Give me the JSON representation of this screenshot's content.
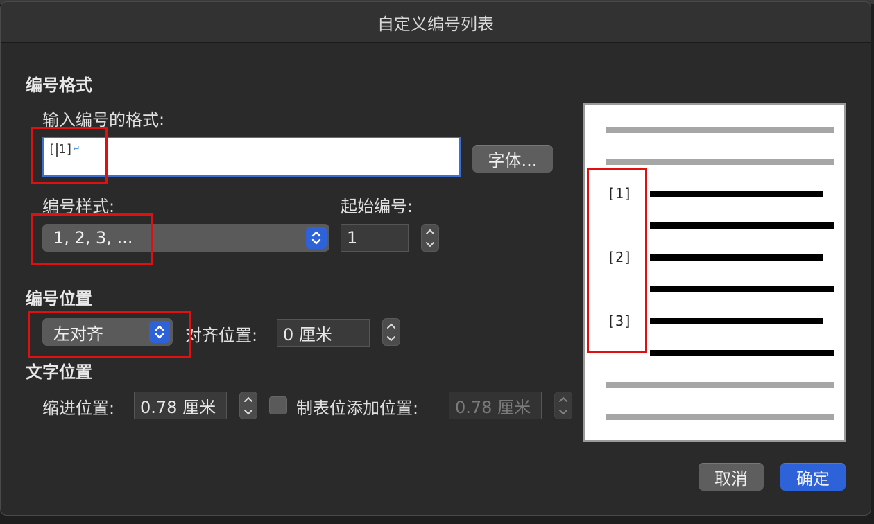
{
  "dialog": {
    "title": "自定义编号列表"
  },
  "number_format": {
    "section_title": "编号格式",
    "input_label": "输入编号的格式:",
    "format_left": "[",
    "format_right": "1]",
    "font_button": "字体...",
    "style_label": "编号样式:",
    "style_value": "1, 2, 3, ...",
    "start_label": "起始编号:",
    "start_value": "1"
  },
  "number_position": {
    "section_title": "编号位置",
    "alignment_value": "左对齐",
    "align_at_label": "对齐位置:",
    "align_at_value": "0 厘米"
  },
  "text_position": {
    "section_title": "文字位置",
    "indent_label": "缩进位置:",
    "indent_value": "0.78 厘米",
    "tab_checkbox_label": "制表位添加位置:",
    "tab_checked": false,
    "tab_value": "0.78 厘米"
  },
  "preview": {
    "markers": [
      "[1]",
      "[2]",
      "[3]"
    ]
  },
  "buttons": {
    "cancel": "取消",
    "ok": "确定"
  },
  "colors": {
    "accent": "#2d62d8",
    "highlight": "#e01010"
  }
}
